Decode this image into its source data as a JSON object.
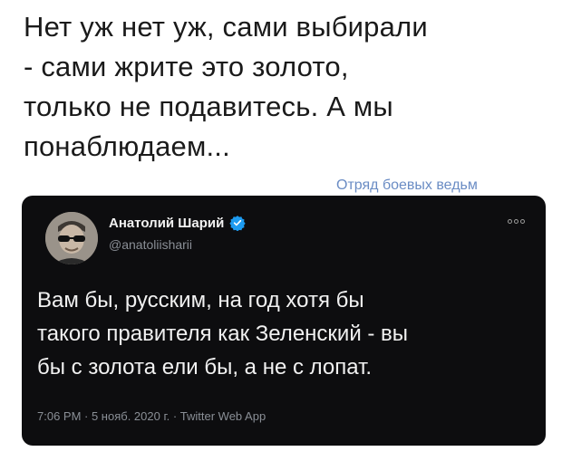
{
  "caption": {
    "lines": [
      "Нет уж нет уж, сами выбирали",
      "- сами жрите это золото,",
      "только не подавитесь. А мы",
      "понаблюдаем..."
    ]
  },
  "watermark": "Отряд боевых ведьм",
  "tweet": {
    "author_name": "Анатолий Шарий",
    "handle": "@anatoliisharii",
    "text_lines": [
      "Вам бы, русским, на год хотя бы",
      "такого правителя как Зеленский - вы",
      "бы с золота ели бы, а не с лопат."
    ],
    "meta": "7:06 PM · 5 нояб. 2020 г. · Twitter Web App",
    "verified_color": "#1d9bf0",
    "background_color": "#0d0d0f"
  },
  "icons": {
    "verified": "verified-badge-icon",
    "more": "more-options-icon",
    "avatar": "avatar"
  }
}
